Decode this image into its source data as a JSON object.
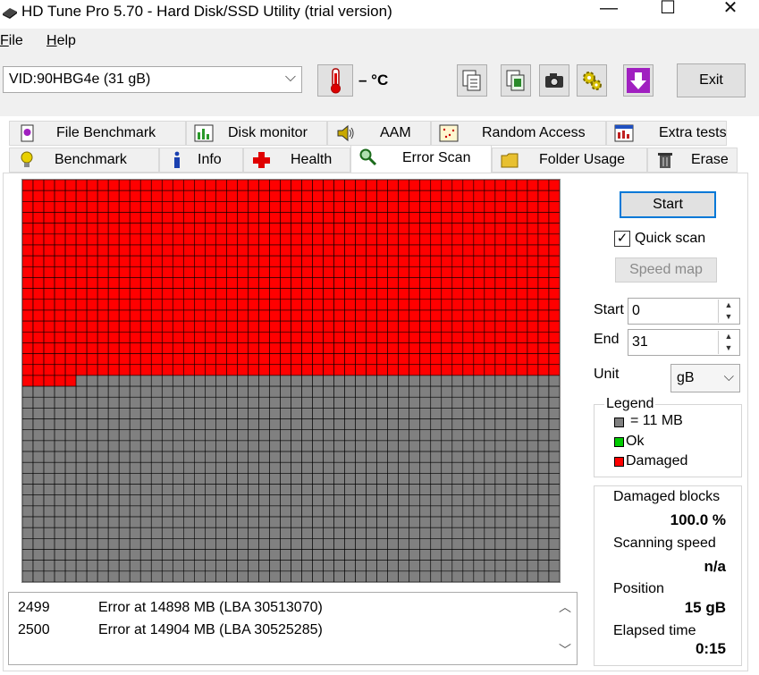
{
  "window": {
    "title": "HD Tune Pro 5.70 - Hard Disk/SSD Utility (trial version)",
    "min_glyph": "—",
    "max_glyph": "☐",
    "close_glyph": "✕"
  },
  "menu": {
    "file": "File",
    "help": "Help"
  },
  "toolbar": {
    "device": "VID:90HBG4e (31 gB)",
    "temperature": "– °C",
    "exit_label": "Exit",
    "icons": [
      "thermometer-icon",
      "copy-icon",
      "copy-info-icon",
      "camera-icon",
      "settings-icon",
      "save-download-icon"
    ]
  },
  "tabs": {
    "row1": [
      "File Benchmark",
      "Disk monitor",
      "AAM",
      "Random Access",
      "Extra tests"
    ],
    "row2": [
      "Benchmark",
      "Info",
      "Health",
      "Error Scan",
      "Folder Usage",
      "Erase"
    ],
    "active": "Error Scan"
  },
  "scan": {
    "cols": 50,
    "rows": 37,
    "damaged_blocks": 905,
    "colors": {
      "damaged": "#ff0000",
      "untested": "#808080",
      "ok": "#00cc00",
      "grid_line": "#000000"
    }
  },
  "log": {
    "rows": [
      {
        "num": "2499",
        "msg": "Error at 14898 MB (LBA 30513070)"
      },
      {
        "num": "2500",
        "msg": "Error at 14904 MB (LBA 30525285)"
      }
    ]
  },
  "controls": {
    "start_button": "Start",
    "quick_scan_label": "Quick scan",
    "quick_scan_checked": true,
    "speed_map_button": "Speed map",
    "start_label": "Start",
    "start_value": "0",
    "end_label": "End",
    "end_value": "31",
    "unit_label": "Unit",
    "unit_value": "gB"
  },
  "legend": {
    "title": "Legend",
    "block_size": "= 11 MB",
    "ok": "Ok",
    "damaged": "Damaged"
  },
  "stats": {
    "damaged_blocks_label": "Damaged blocks",
    "damaged_blocks_value": "100.0 %",
    "scanning_speed_label": "Scanning speed",
    "scanning_speed_value": "n/a",
    "position_label": "Position",
    "position_value": "15 gB",
    "elapsed_label": "Elapsed time",
    "elapsed_value": "0:15"
  }
}
